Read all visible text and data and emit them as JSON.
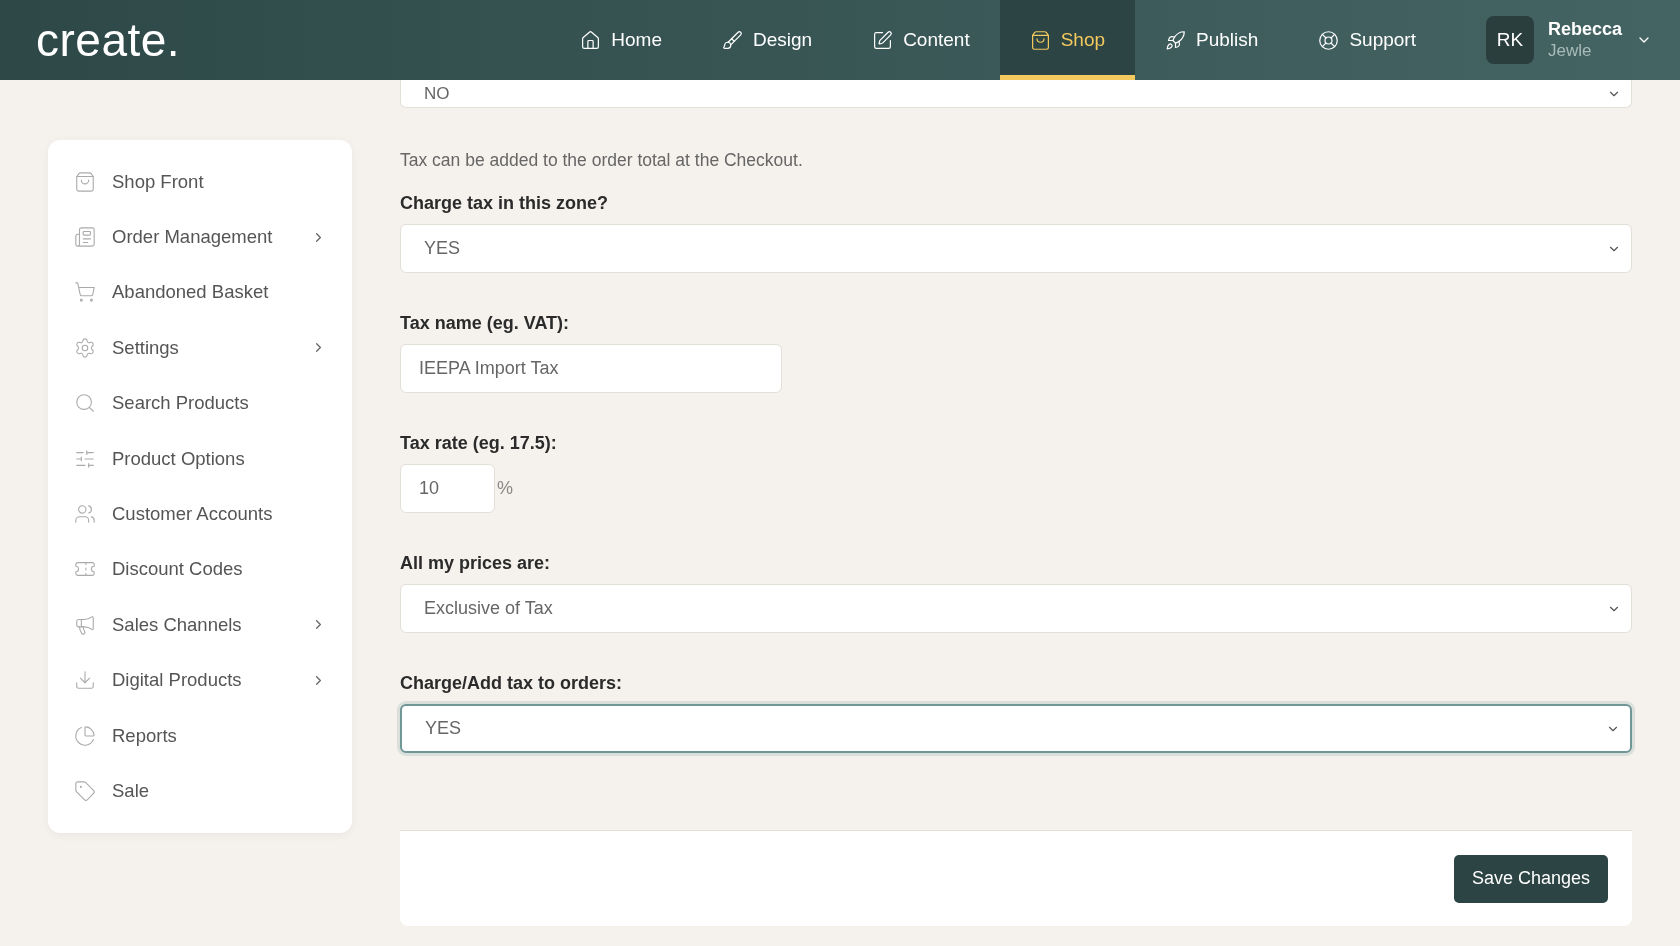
{
  "header": {
    "logo": "create.",
    "nav": [
      {
        "label": "Home",
        "selected": false
      },
      {
        "label": "Design",
        "selected": false
      },
      {
        "label": "Content",
        "selected": false
      },
      {
        "label": "Shop",
        "selected": true
      },
      {
        "label": "Publish",
        "selected": false
      },
      {
        "label": "Support",
        "selected": false
      }
    ],
    "user": {
      "initials": "RK",
      "name": "Rebecca",
      "subtitle": "Jewle"
    }
  },
  "sidebar": {
    "items": [
      {
        "label": "Shop Front",
        "has_submenu": false
      },
      {
        "label": "Order Management",
        "has_submenu": true
      },
      {
        "label": "Abandoned Basket",
        "has_submenu": false
      },
      {
        "label": "Settings",
        "has_submenu": true
      },
      {
        "label": "Search Products",
        "has_submenu": false
      },
      {
        "label": "Product Options",
        "has_submenu": false
      },
      {
        "label": "Customer Accounts",
        "has_submenu": false
      },
      {
        "label": "Discount Codes",
        "has_submenu": false
      },
      {
        "label": "Sales Channels",
        "has_submenu": true
      },
      {
        "label": "Digital Products",
        "has_submenu": true
      },
      {
        "label": "Reports",
        "has_submenu": false
      },
      {
        "label": "Sale",
        "has_submenu": false
      }
    ]
  },
  "form": {
    "top_select": {
      "value": "NO"
    },
    "hint": "Tax can be added to the order total at the Checkout.",
    "fields": [
      {
        "kind": "select",
        "label": "Charge tax in this zone?",
        "value": "YES",
        "focused": false
      },
      {
        "kind": "text",
        "label": "Tax name (eg. VAT):",
        "value": "IEEPA Import Tax",
        "focused": false
      },
      {
        "kind": "rate",
        "label": "Tax rate (eg. 17.5):",
        "value": "10",
        "unit": "%",
        "focused": false
      },
      {
        "kind": "select",
        "label": "All my prices are:",
        "value": "Exclusive of Tax",
        "focused": false
      },
      {
        "kind": "select",
        "label": "Charge/Add tax to orders:",
        "value": "YES",
        "focused": true
      }
    ],
    "save_button": "Save Changes"
  }
}
